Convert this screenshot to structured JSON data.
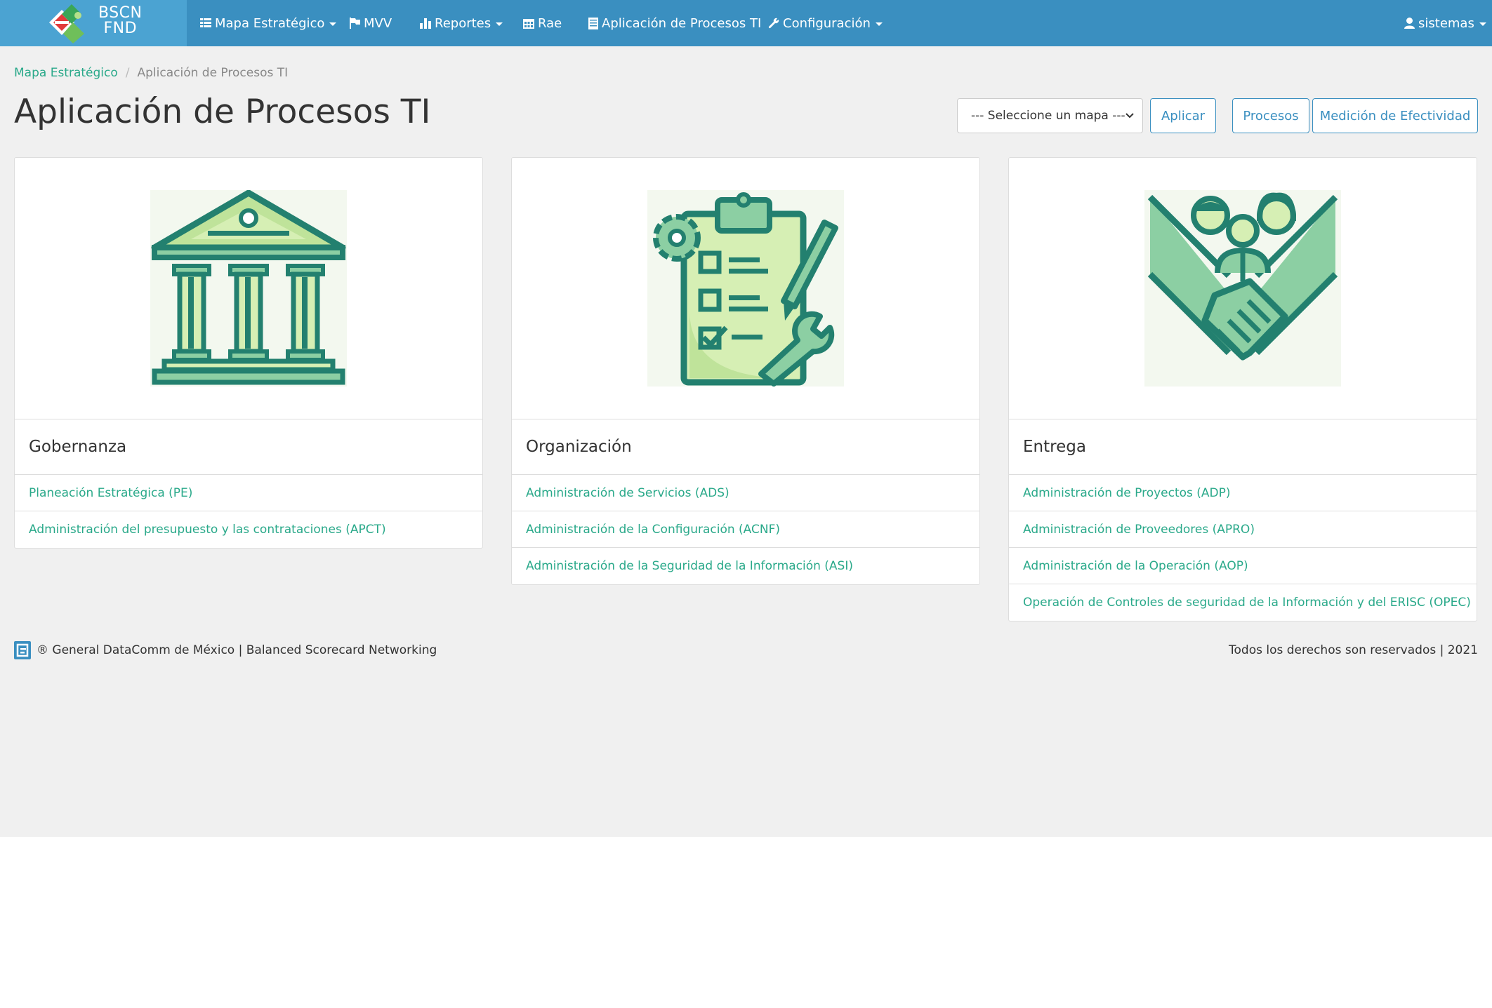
{
  "brand": {
    "line1": "BSCN",
    "line2": "FND"
  },
  "nav": {
    "items": [
      {
        "label": "Mapa Estratégico",
        "icon": "list-icon",
        "dropdown": true
      },
      {
        "label": "MVV",
        "icon": "flag-icon",
        "dropdown": false
      },
      {
        "label": "Reportes",
        "icon": "bar-chart-icon",
        "dropdown": true
      },
      {
        "label": "Rae",
        "icon": "calendar-icon",
        "dropdown": false
      },
      {
        "label": "Aplicación de Procesos TI",
        "icon": "document-icon",
        "dropdown": false
      },
      {
        "label": "Configuración",
        "icon": "wrench-icon",
        "dropdown": true
      }
    ],
    "user": {
      "label": "sistemas",
      "icon": "user-icon"
    }
  },
  "breadcrumb": {
    "home": "Mapa Estratégico",
    "separator": "/",
    "current": "Aplicación de Procesos TI"
  },
  "page": {
    "title": "Aplicación de Procesos TI"
  },
  "toolbar": {
    "select_value": "--- Seleccione un mapa ---",
    "apply_label": "Aplicar",
    "processes_label": "Procesos",
    "effectiveness_label": "Medición de Efectividad"
  },
  "cards": [
    {
      "title": "Gobernanza",
      "icon": "government-building-icon",
      "links": [
        "Planeación Estratégica (PE)",
        "Administración del presupuesto y las contrataciones (APCT)"
      ]
    },
    {
      "title": "Organización",
      "icon": "clipboard-tools-icon",
      "links": [
        "Administración de Servicios (ADS)",
        "Administración de la Configuración (ACNF)",
        "Administración de la Seguridad de la Información (ASI)"
      ]
    },
    {
      "title": "Entrega",
      "icon": "handshake-team-icon",
      "links": [
        "Administración de Proyectos (ADP)",
        "Administración de Proveedores (APRO)",
        "Administración de la Operación (AOP)",
        "Operación de Controles de seguridad de la Información y del ERISC (OPEC)"
      ]
    }
  ],
  "footer": {
    "left": "® General DataComm de México | Balanced Scorecard Networking",
    "right": "Todos los derechos son reservados | 2021"
  },
  "colors": {
    "navbar": "#3a8fc0",
    "brand_bg": "#4ba3d2",
    "link": "#2aa98a",
    "icon_dark": "#23806f",
    "icon_mid": "#8ccfa3",
    "icon_light": "#d6efb4",
    "page_bg": "#f0f0f0"
  }
}
